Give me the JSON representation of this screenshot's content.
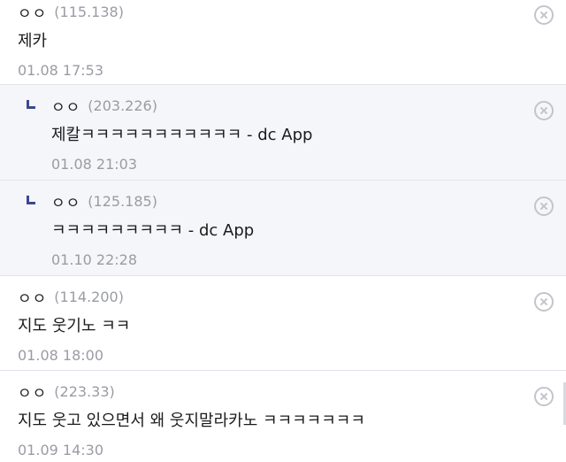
{
  "comments": [
    {
      "nick": "ㅇㅇ",
      "ip": "(115.138)",
      "text": "제카",
      "date": "01.08 17:53"
    },
    {
      "nick": "ㅇㅇ",
      "ip": "(203.226)",
      "text": "제칼ㅋㅋㅋㅋㅋㅋㅋㅋㅋㅋㅋ - dc App",
      "date": "01.08 21:03"
    },
    {
      "nick": "ㅇㅇ",
      "ip": "(125.185)",
      "text": "ㅋㅋㅋㅋㅋㅋㅋㅋㅋ - dc App",
      "date": "01.10 22:28"
    },
    {
      "nick": "ㅇㅇ",
      "ip": "(114.200)",
      "text": "지도 웃기노 ㅋㅋ",
      "date": "01.08 18:00"
    },
    {
      "nick": "ㅇㅇ",
      "ip": "(223.33)",
      "text": "지도 웃고 있으면서 왜 웃지말라카노 ㅋㅋㅋㅋㅋㅋㅋ",
      "date": "01.09 14:30"
    }
  ]
}
